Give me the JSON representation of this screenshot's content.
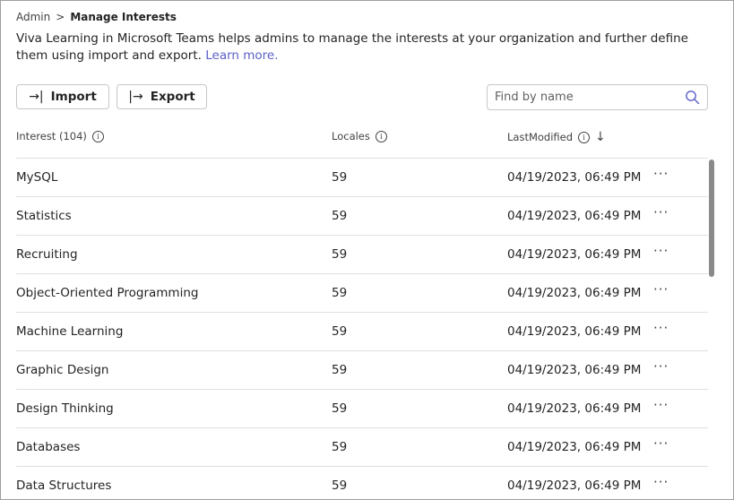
{
  "breadcrumb": {
    "parent": "Admin",
    "separator": ">",
    "current": "Manage Interests"
  },
  "description": {
    "text": "Viva Learning in Microsoft Teams helps admins to manage the interests at your organization and further define them using import and export.",
    "link": "Learn more."
  },
  "toolbar": {
    "import_icon": "→|",
    "import_label": "Import",
    "export_icon": "|→",
    "export_label": "Export"
  },
  "search": {
    "placeholder": "Find by name",
    "icon": "search-icon"
  },
  "table": {
    "headers": {
      "interest": "Interest (104)",
      "locales": "Locales",
      "last_modified": "LastModified"
    },
    "info_glyph": "i",
    "sort_glyph": "↓",
    "more_glyph": "···",
    "rows": [
      {
        "interest": "MySQL",
        "locales": "59",
        "last_modified": "04/19/2023, 06:49 PM"
      },
      {
        "interest": "Statistics",
        "locales": "59",
        "last_modified": "04/19/2023, 06:49 PM"
      },
      {
        "interest": "Recruiting",
        "locales": "59",
        "last_modified": "04/19/2023, 06:49 PM"
      },
      {
        "interest": "Object-Oriented Programming",
        "locales": "59",
        "last_modified": "04/19/2023, 06:49 PM"
      },
      {
        "interest": "Machine Learning",
        "locales": "59",
        "last_modified": "04/19/2023, 06:49 PM"
      },
      {
        "interest": "Graphic Design",
        "locales": "59",
        "last_modified": "04/19/2023, 06:49 PM"
      },
      {
        "interest": "Design Thinking",
        "locales": "59",
        "last_modified": "04/19/2023, 06:49 PM"
      },
      {
        "interest": "Databases",
        "locales": "59",
        "last_modified": "04/19/2023, 06:49 PM"
      },
      {
        "interest": "Data Structures",
        "locales": "59",
        "last_modified": "04/19/2023, 06:49 PM"
      }
    ]
  },
  "colors": {
    "link": "#5b5fc7",
    "border": "#c7c7c7",
    "divider": "#e0e0e0"
  }
}
